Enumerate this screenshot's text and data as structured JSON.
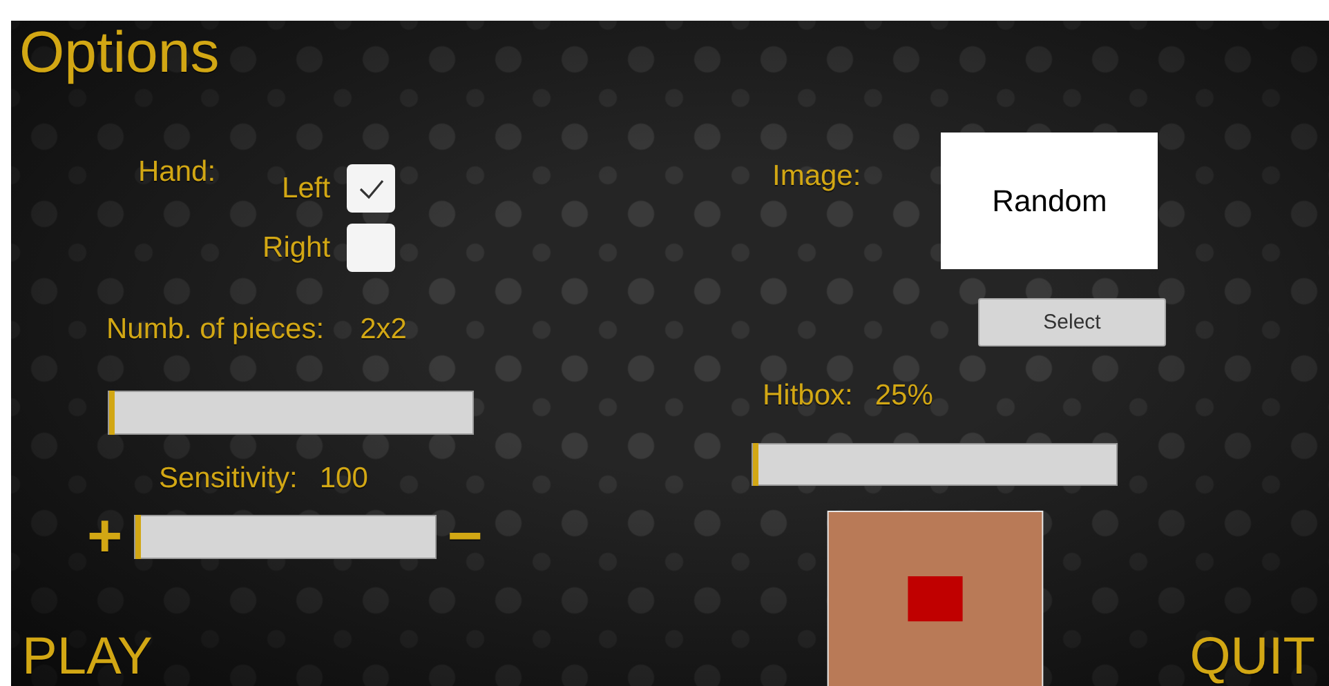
{
  "title": "Options",
  "hand": {
    "label": "Hand:",
    "options": [
      {
        "label": "Left",
        "checked": true
      },
      {
        "label": "Right",
        "checked": false
      }
    ]
  },
  "pieces": {
    "label": "Numb. of pieces:",
    "value": "2x2",
    "level": 0
  },
  "sensitivity": {
    "label": "Sensitivity:",
    "value": "100",
    "level": 0,
    "increase": "+",
    "decrease": "−"
  },
  "image": {
    "label": "Image:",
    "value": "Random",
    "button": "Select"
  },
  "hitbox": {
    "label": "Hitbox:",
    "value": "25%",
    "level": 0
  },
  "play": "PLAY",
  "quit": "QUIT"
}
